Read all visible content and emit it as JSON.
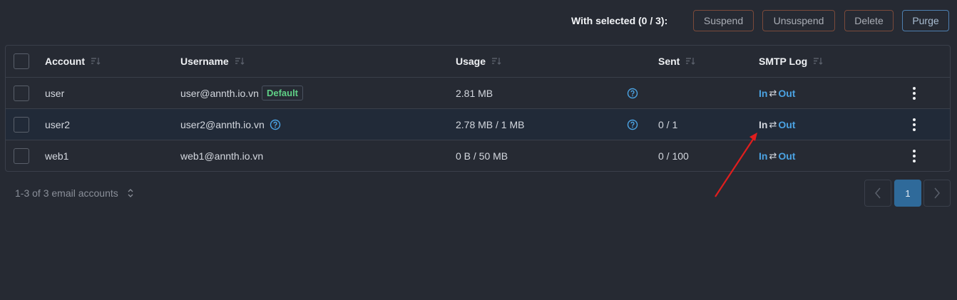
{
  "toolbar": {
    "with_selected": "With selected (0 / 3):",
    "suspend": "Suspend",
    "unsuspend": "Unsuspend",
    "delete": "Delete",
    "purge": "Purge"
  },
  "table": {
    "columns": [
      "Account",
      "Username",
      "Usage",
      "Sent",
      "SMTP Log"
    ],
    "rows": [
      {
        "account": "user",
        "username": "user@annth.io.vn",
        "badge": "Default",
        "usage": "2.81 MB",
        "sent": "",
        "smtp_in": "In",
        "smtp_out": "Out"
      },
      {
        "account": "user2",
        "username": "user2@annth.io.vn",
        "usage": "2.78 MB / 1 MB",
        "sent": "0 / 1",
        "smtp_in": "In",
        "smtp_out": "Out"
      },
      {
        "account": "web1",
        "username": "web1@annth.io.vn",
        "usage": "0 B / 50 MB",
        "sent": "0 / 100",
        "smtp_in": "In",
        "smtp_out": "Out"
      }
    ]
  },
  "footer": {
    "count": "1-3 of 3 email accounts",
    "current_page": "1"
  },
  "icons": {
    "sort": "sort-icon",
    "help": "help-icon",
    "kebab": "kebab-menu-icon",
    "swap": "swap-arrows-icon",
    "chevron_left": "chevron-left-icon",
    "chevron_right": "chevron-right-icon"
  },
  "colors": {
    "background": "#262a33",
    "accent": "#4ba3e3",
    "badge_green": "#5fcf86",
    "danger_border": "#7a4a3a",
    "page_active": "#2f6a9a",
    "annotation_arrow": "#e01e1e"
  }
}
